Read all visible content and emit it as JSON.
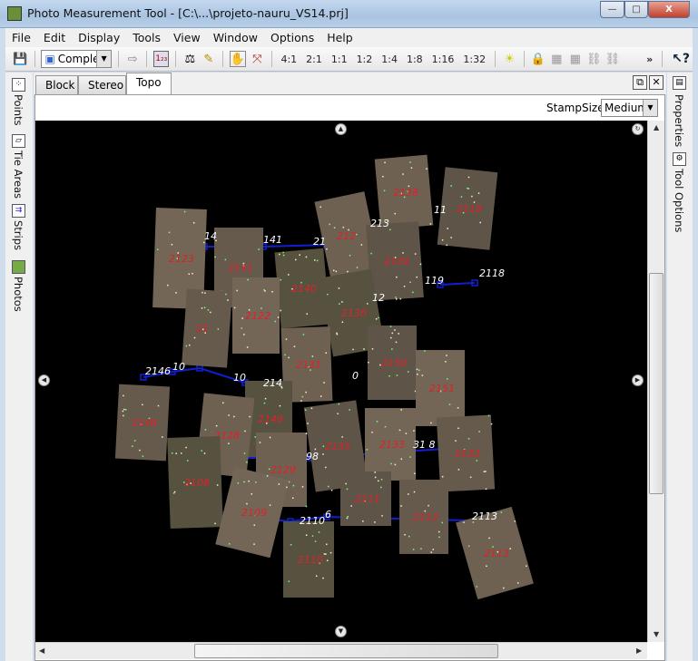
{
  "window": {
    "title": "Photo Measurement Tool - [C:\\...\\projeto-nauru_VS14.prj]",
    "minimize": "—",
    "maximize": "□",
    "close": "X"
  },
  "menu": [
    "File",
    "Edit",
    "Display",
    "Tools",
    "View",
    "Window",
    "Options",
    "Help"
  ],
  "toolbar": {
    "mode_value": "Complete",
    "zoom_levels": [
      "4:1",
      "2:1",
      "1:1",
      "1:2",
      "1:4",
      "1:8",
      "1:16",
      "1:32"
    ],
    "overflow": "»",
    "help": "?"
  },
  "left_panel": [
    "Points",
    "Tie Areas",
    "Strips",
    "Photos"
  ],
  "right_panel": [
    "Properties",
    "Tool Options"
  ],
  "tabs": [
    {
      "label": "Block"
    },
    {
      "label": "Stereo"
    },
    {
      "label": "Topo",
      "active": true
    }
  ],
  "stamp": {
    "label": "StampSize:",
    "value": "Medium"
  },
  "map": {
    "photo_labels": [
      "2138",
      "2118",
      "2123",
      "2141",
      "2140",
      "212",
      "2139",
      "2122",
      "21",
      "2130",
      "2131",
      "2150",
      "2151",
      "2148",
      "2149",
      "2128",
      "2135",
      "2133",
      "2132",
      "2108",
      "2129",
      "2111",
      "2109",
      "2112",
      "2110",
      "2113"
    ],
    "strip_labels": [
      "14",
      "141",
      "21",
      "213",
      "11",
      "119",
      "2118",
      "12",
      "2146",
      "10",
      "10",
      "214",
      "0",
      "98",
      "31 8",
      "2110",
      "6",
      "2113"
    ],
    "colors": {
      "photo_label": "#e0202a",
      "strip_line": "#1020d0",
      "strip_label": "#ffffff",
      "background": "#000000"
    }
  }
}
